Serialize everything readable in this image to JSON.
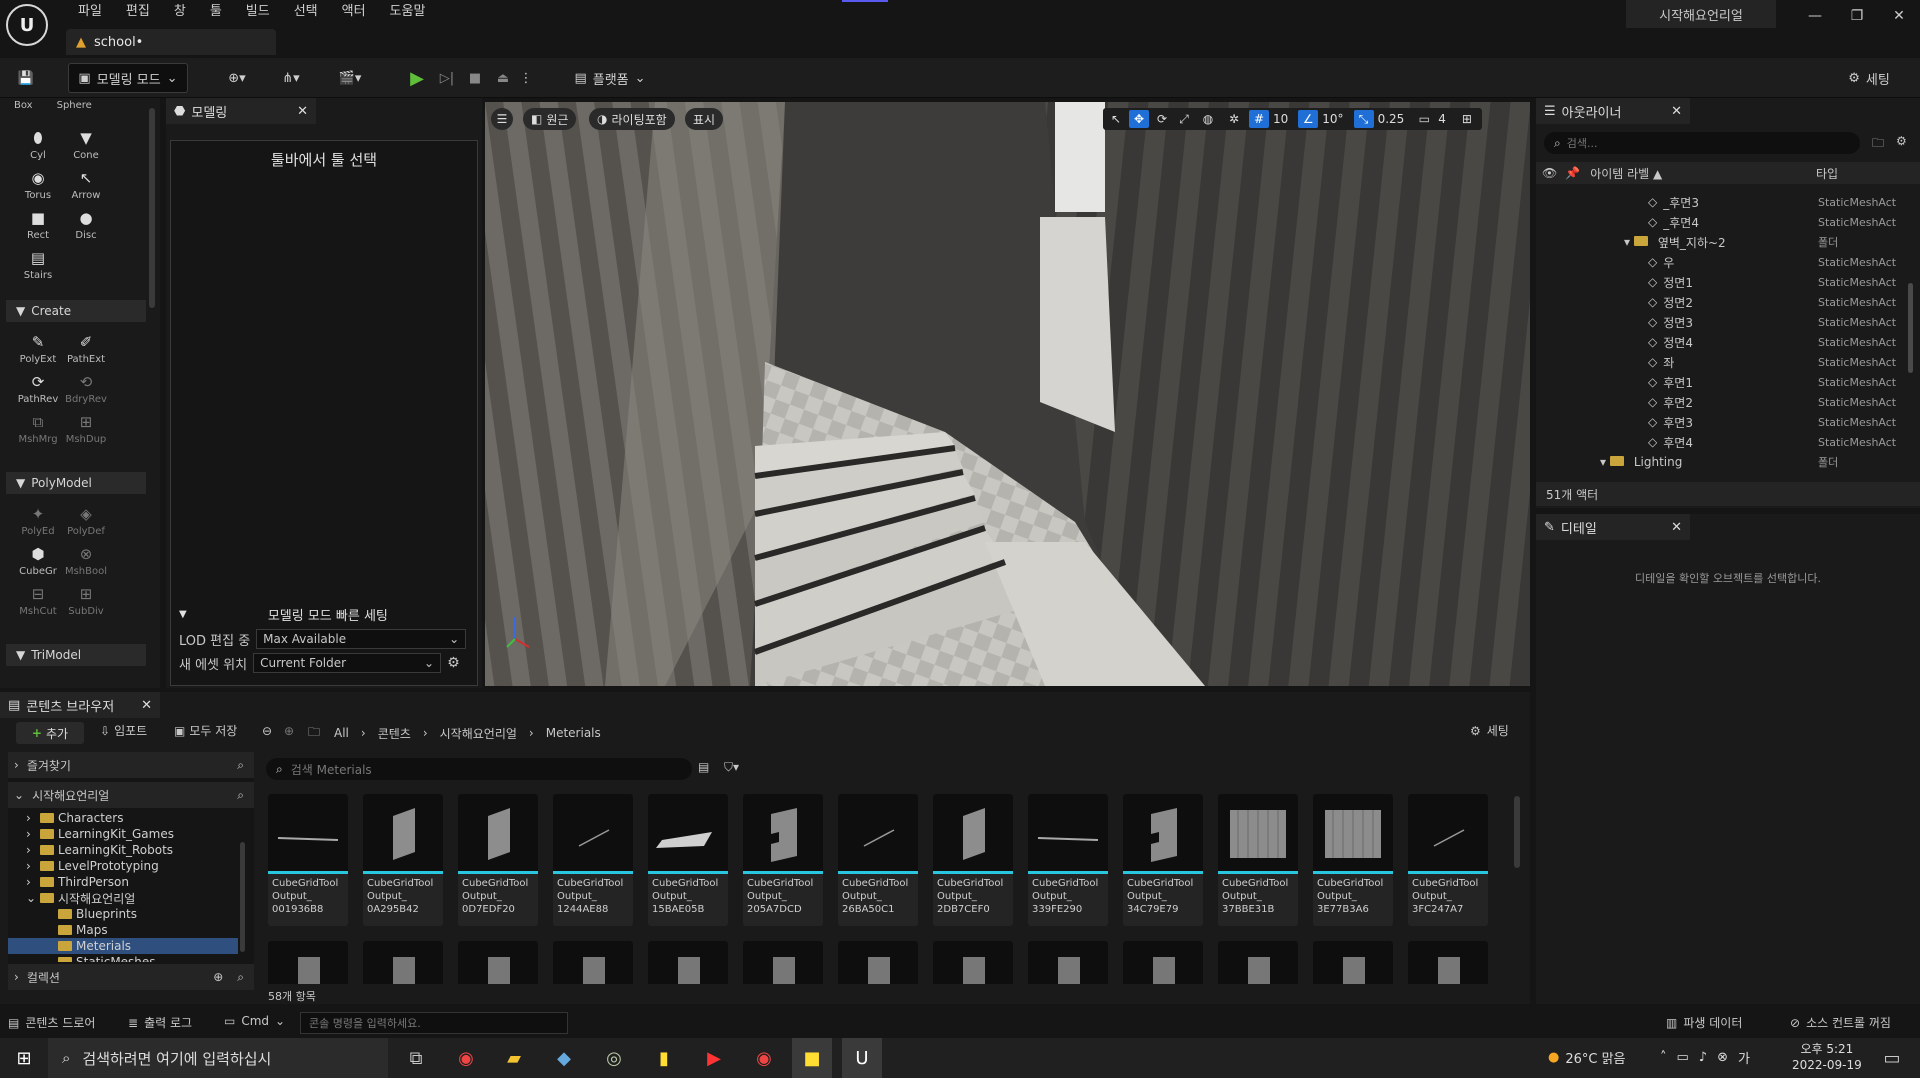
{
  "colors": {
    "accent": "#29c6e0",
    "play_green": "#5fbf3a",
    "selection": "#2f4f7f",
    "folder": "#c9a53b"
  },
  "menu": [
    "파일",
    "편집",
    "창",
    "툴",
    "빌드",
    "선택",
    "액터",
    "도움말"
  ],
  "doc_tab": "school•",
  "project_name": "시작해요언리얼",
  "toolbar": {
    "mode": "모델링 모드",
    "platform": "플랫폼",
    "settings": "세팅"
  },
  "shapes": {
    "partial": [
      "Box",
      "Sphere"
    ],
    "items": [
      "Cyl",
      "Cone",
      "Torus",
      "Arrow",
      "Rect",
      "Disc",
      "Stairs"
    ]
  },
  "create": {
    "title": "Create",
    "items": [
      "PolyExt",
      "PathExt",
      "PathRev",
      "BdryRev",
      "MshMrg",
      "MshDup"
    ]
  },
  "polymodel": {
    "title": "PolyModel",
    "items": [
      "PolyEd",
      "PolyDef",
      "CubeGr",
      "MshBool",
      "MshCut",
      "SubDiv"
    ]
  },
  "trimodel": {
    "title": "TriModel"
  },
  "modeling_panel": {
    "tab": "모델링",
    "select_tool": "툴바에서 툴 선택",
    "quick_settings": "모델링 모드 빠른 세팅",
    "lod_label": "LOD 편집 중",
    "lod_value": "Max Available",
    "asset_label": "새 에셋 위치",
    "asset_value": "Current Folder"
  },
  "viewport": {
    "perspective": "원근",
    "lighting": "라이팅포함",
    "show": "표시",
    "grid": "10",
    "angle": "10°",
    "scale": "0.25",
    "camera": "4"
  },
  "outliner": {
    "tab": "아웃라이너",
    "search_placeholder": "검색...",
    "col_label": "아이템 라벨 ▲",
    "col_type": "타입",
    "rows": [
      {
        "label": "_후면3",
        "type": "StaticMeshAct",
        "indent": 3,
        "kind": "mesh"
      },
      {
        "label": "_후면4",
        "type": "StaticMeshAct",
        "indent": 3,
        "kind": "mesh"
      },
      {
        "label": "옆벽_지하~2",
        "type": "폴더",
        "indent": 2,
        "kind": "folder"
      },
      {
        "label": "우",
        "type": "StaticMeshAct",
        "indent": 3,
        "kind": "mesh"
      },
      {
        "label": "정면1",
        "type": "StaticMeshAct",
        "indent": 3,
        "kind": "mesh"
      },
      {
        "label": "정면2",
        "type": "StaticMeshAct",
        "indent": 3,
        "kind": "mesh"
      },
      {
        "label": "정면3",
        "type": "StaticMeshAct",
        "indent": 3,
        "kind": "mesh"
      },
      {
        "label": "정면4",
        "type": "StaticMeshAct",
        "indent": 3,
        "kind": "mesh"
      },
      {
        "label": "좌",
        "type": "StaticMeshAct",
        "indent": 3,
        "kind": "mesh"
      },
      {
        "label": "후면1",
        "type": "StaticMeshAct",
        "indent": 3,
        "kind": "mesh"
      },
      {
        "label": "후면2",
        "type": "StaticMeshAct",
        "indent": 3,
        "kind": "mesh"
      },
      {
        "label": "후면3",
        "type": "StaticMeshAct",
        "indent": 3,
        "kind": "mesh"
      },
      {
        "label": "후면4",
        "type": "StaticMeshAct",
        "indent": 3,
        "kind": "mesh"
      },
      {
        "label": "Lighting",
        "type": "폴더",
        "indent": 1,
        "kind": "folder"
      }
    ],
    "count": "51개 액터"
  },
  "details": {
    "tab": "디테일",
    "empty": "디테일을 확인할 오브젝트를 선택합니다."
  },
  "content_browser": {
    "tab": "콘텐츠 브라우저",
    "add": "추가",
    "import": "임포트",
    "save_all": "모두 저장",
    "settings": "세팅",
    "path": [
      "All",
      "콘텐츠",
      "시작해요언리얼",
      "Meterials"
    ],
    "favorites": "즐겨찾기",
    "root": "시작해요언리얼",
    "search_placeholder": "검색 Meterials",
    "folders": [
      {
        "name": "Characters",
        "indent": 1
      },
      {
        "name": "LearningKit_Games",
        "indent": 1
      },
      {
        "name": "LearningKit_Robots",
        "indent": 1
      },
      {
        "name": "LevelPrototyping",
        "indent": 1
      },
      {
        "name": "ThirdPerson",
        "indent": 1
      },
      {
        "name": "시작해요언리얼",
        "indent": 1
      },
      {
        "name": "Blueprints",
        "indent": 2
      },
      {
        "name": "Maps",
        "indent": 2
      },
      {
        "name": "Meterials",
        "indent": 2
      },
      {
        "name": "StaticMeshes",
        "indent": 2
      }
    ],
    "collections": "컬렉션",
    "item_count": "58개 항목",
    "assets": [
      {
        "l1": "CubeGridTool",
        "l2": "Output_",
        "l3": "001936B8",
        "shape": "line"
      },
      {
        "l1": "CubeGridTool",
        "l2": "Output_",
        "l3": "0A295B42",
        "shape": "panel"
      },
      {
        "l1": "CubeGridTool",
        "l2": "Output_",
        "l3": "0D7EDF20",
        "shape": "panel"
      },
      {
        "l1": "CubeGridTool",
        "l2": "Output_",
        "l3": "1244AE88",
        "shape": "slant"
      },
      {
        "l1": "CubeGridTool",
        "l2": "Output_",
        "l3": "15BAE05B",
        "shape": "flat"
      },
      {
        "l1": "CubeGridTool",
        "l2": "Output_",
        "l3": "205A7DCD",
        "shape": "notch"
      },
      {
        "l1": "CubeGridTool",
        "l2": "Output_",
        "l3": "26BA50C1",
        "shape": "slant"
      },
      {
        "l1": "CubeGridTool",
        "l2": "Output_",
        "l3": "2DB7CEF0",
        "shape": "panel"
      },
      {
        "l1": "CubeGridTool",
        "l2": "Output_",
        "l3": "339FE290",
        "shape": "line"
      },
      {
        "l1": "CubeGridTool",
        "l2": "Output_",
        "l3": "34C79E79",
        "shape": "notch"
      },
      {
        "l1": "CubeGridTool",
        "l2": "Output_",
        "l3": "37BBE31B",
        "shape": "wall"
      },
      {
        "l1": "CubeGridTool",
        "l2": "Output_",
        "l3": "3E77B3A6",
        "shape": "wall"
      },
      {
        "l1": "CubeGridTool",
        "l2": "Output_",
        "l3": "3FC247A7",
        "shape": "slant"
      }
    ]
  },
  "statusbar": {
    "content_drawer": "콘텐츠 드로어",
    "output_log": "출력 로그",
    "cmd": "Cmd",
    "console_placeholder": "콘솔 명령을 입력하세요.",
    "derived_data": "파생 데이터",
    "source_control": "소스 컨트롤 꺼짐"
  },
  "taskbar": {
    "search": "검색하려면 여기에 입력하십시",
    "weather": "26°C 맑음",
    "time": "오후 5:21",
    "date": "2022-09-19"
  }
}
